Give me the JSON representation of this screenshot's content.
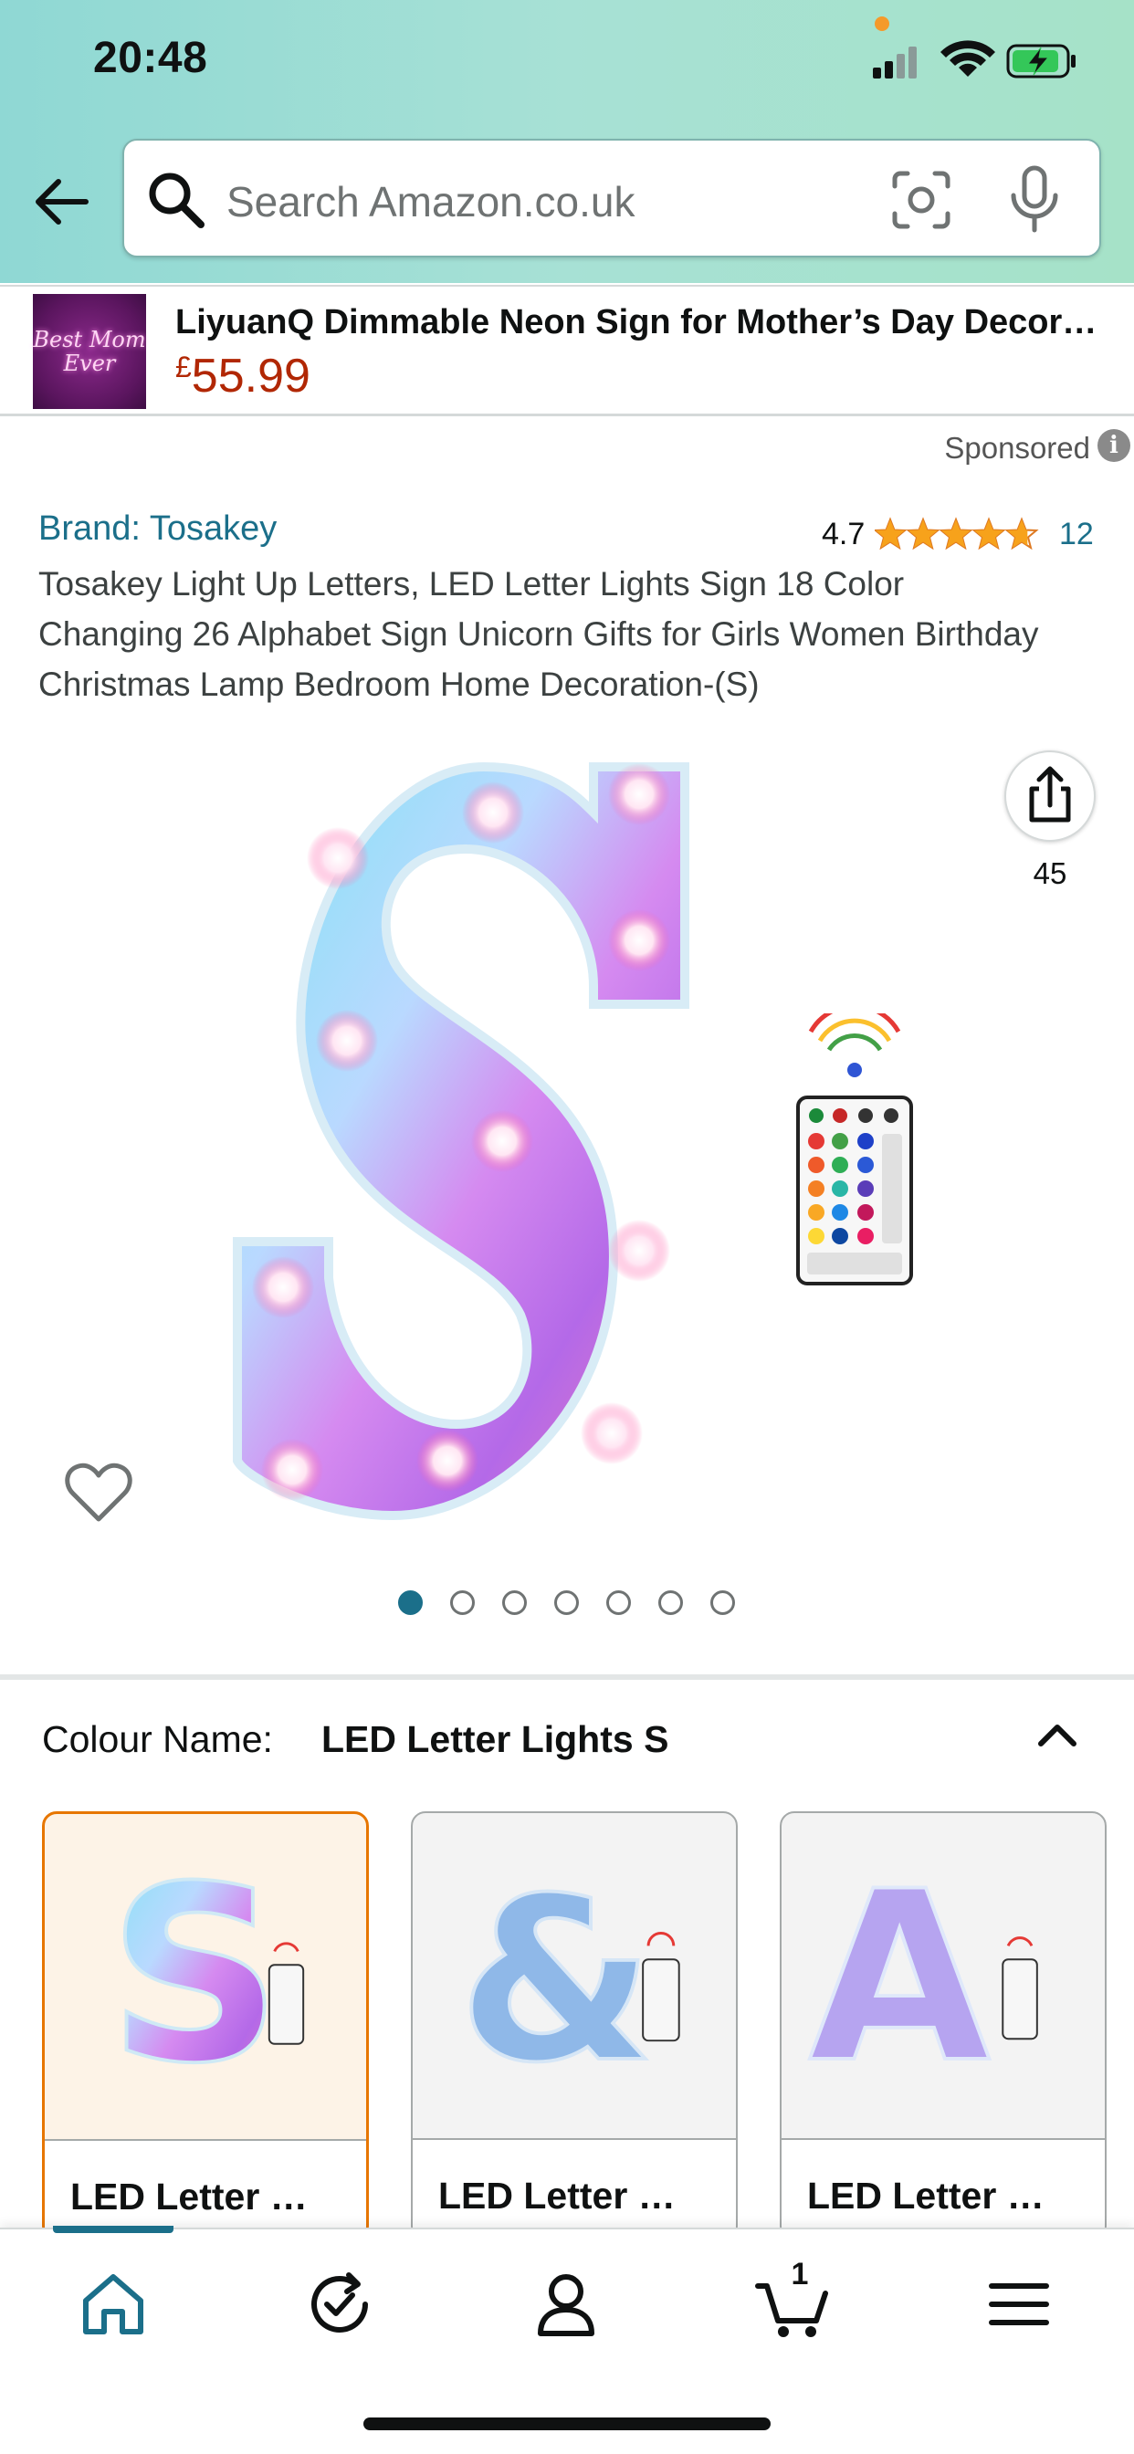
{
  "status_bar": {
    "time": "20:48"
  },
  "search": {
    "placeholder": "Search Amazon.co.uk"
  },
  "sponsored_ad": {
    "thumb_text": "Best Mom Ever",
    "title": "LiyuanQ Dimmable Neon Sign for Mother’s Day Decor…",
    "currency": "£",
    "price": "55.99",
    "sponsored_label": "Sponsored"
  },
  "product": {
    "brand": "Brand: Tosakey",
    "rating": "4.7",
    "rating_fraction": 0.94,
    "rating_count": "12",
    "title": "Tosakey Light Up Letters, LED Letter Lights Sign 18 Color Changing 26 Alphabet Sign Unicorn Gifts for Girls Women Birthday Christmas Lamp Bedroom Home Decoration-(S)",
    "share_count": "45",
    "image_count": 7,
    "active_image_index": 0
  },
  "variations": {
    "label": "Colour Name:",
    "selected": "LED Letter Lights S",
    "options": [
      {
        "label": "LED Letter …",
        "glyph": "S"
      },
      {
        "label": "LED Letter …",
        "glyph": "&"
      },
      {
        "label": "LED Letter …",
        "glyph": "A"
      }
    ]
  },
  "bottom_nav": {
    "items": [
      "home-icon",
      "orders-refresh-icon",
      "account-icon",
      "cart-icon",
      "menu-icon"
    ],
    "cart_count": "1"
  },
  "colors": {
    "header_start": "#8fd8d4",
    "link": "#1b6f8a",
    "price": "#b12704",
    "selected_border": "#e77600",
    "star": "#f7a21b"
  }
}
